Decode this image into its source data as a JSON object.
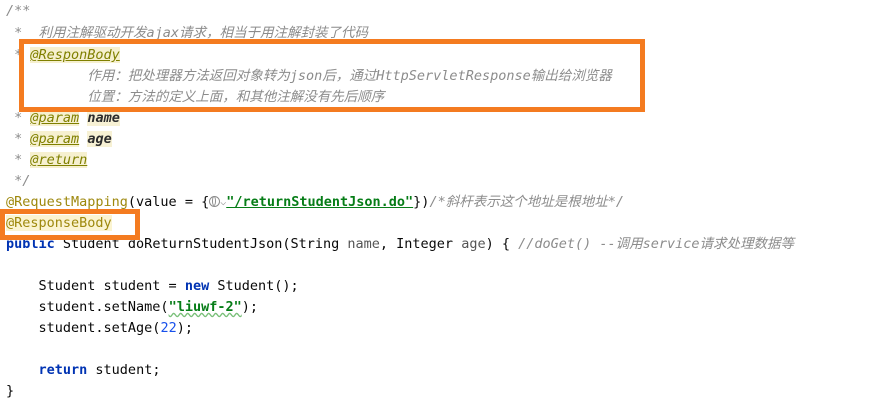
{
  "code": {
    "l1": "/**",
    "l2": " *  利用注解驱动开发ajax请求，相当于用注解封装了代码",
    "l3_prefix": " * ",
    "l3_tag": "@ResponBody",
    "l4": "          作用：把处理器方法返回对象转为json后，通过HttpServletResponse输出给浏览器",
    "l5": "          位置：方法的定义上面，和其他注解没有先后顺序",
    "l6_prefix": " * ",
    "l6_tag": "@param",
    "l6_name": "name",
    "l7_prefix": " * ",
    "l7_tag": "@param",
    "l7_name": "age",
    "l8_prefix": " * ",
    "l8_tag": "@return",
    "l9": " */",
    "l10_ann": "@RequestMapping",
    "l10_a": "(value = {",
    "l10_str": "\"/returnStudentJson.do\"",
    "l10_b": "})",
    "l10_cmt": "/*斜杆表示这个地址是根地址*/",
    "l11": "@ResponseBody",
    "l12_kw": "public",
    "l12_a": " Student doReturnStudentJson(String ",
    "l12_p1": "name",
    "l12_b": ", Integer ",
    "l12_p2": "age",
    "l12_c": ") { ",
    "l12_cmt": "//doGet() --调用service请求处理数据等",
    "l14": "    Student student = ",
    "l14_kw": "new",
    "l14_b": " Student();",
    "l15_a": "    student.setName(",
    "l15_str": "\"liuwf-2\"",
    "l15_b": ");",
    "l16_a": "    student.setAge(",
    "l16_num": "22",
    "l16_b": ");",
    "l18_indent": "    ",
    "l18_kw": "return",
    "l18_b": " student;",
    "l19": "}"
  },
  "colors": {
    "highlight_box": "#f47b20",
    "keyword": "#0033b3",
    "string": "#067d17",
    "comment": "#8c8c8c",
    "annotation": "#9e880d"
  },
  "icons": {
    "url_hint": "globe-icon",
    "dropdown": "chevron-down-icon"
  }
}
